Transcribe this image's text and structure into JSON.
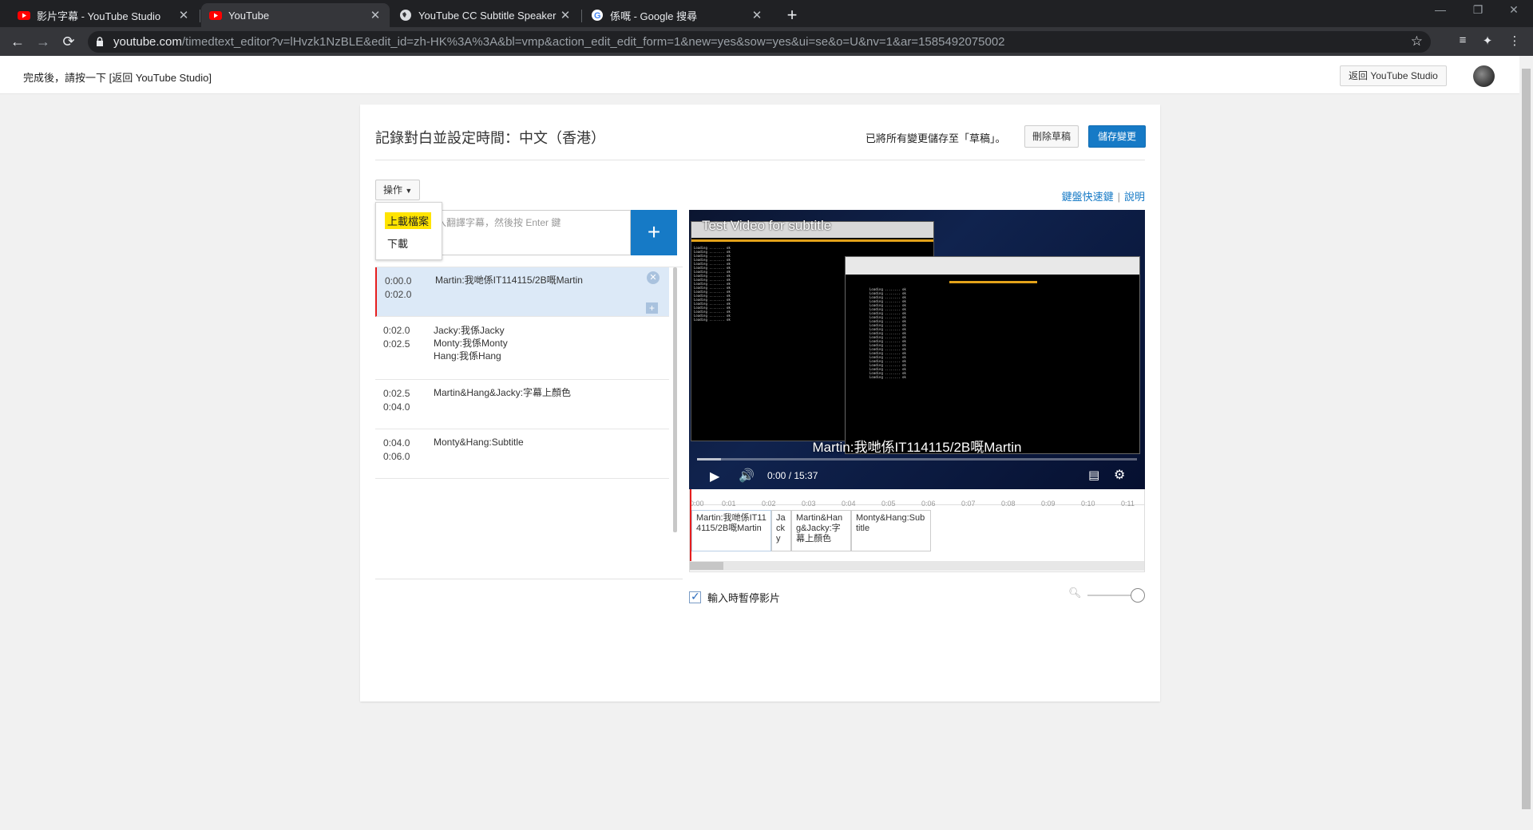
{
  "browser": {
    "tabs": [
      {
        "title": "影片字幕 - YouTube Studio",
        "icon": "youtube-icon"
      },
      {
        "title": "YouTube",
        "icon": "youtube-icon"
      },
      {
        "title": "YouTube CC Subtitle Speaker C",
        "icon": "globe-icon"
      },
      {
        "title": "係嘅 - Google 搜尋",
        "icon": "google-icon"
      }
    ],
    "url_host": "youtube.com",
    "url_rest": "/timedtext_editor?v=lHvzk1NzBLE&edit_id=zh-HK%3A%3A&bl=vmp&action_edit_edit_form=1&new=yes&sow=yes&ui=se&o=U&nv=1&ar=1585492075002"
  },
  "header": {
    "hint": "完成後，請按一下 [返回 YouTube Studio]",
    "back_button": "返回 YouTube Studio"
  },
  "editor": {
    "title": "記錄對白並設定時間：中文（香港）",
    "saved_message": "已將所有變更儲存至「草稿」。",
    "delete_draft": "刪除草稿",
    "save_changes": "儲存變更",
    "actions_label": "操作",
    "actions_menu": [
      "上載檔案",
      "下載"
    ],
    "shortcuts_link": "鍵盤快速鍵",
    "help_link": "說明",
    "input_placeholder": "入翻譯字幕，然後按 Enter 鍵",
    "captions": [
      {
        "start": "0:00.0",
        "end": "0:02.0",
        "lines": [
          "Martin:我哋係IT114115/2B嘅Martin"
        ]
      },
      {
        "start": "0:02.0",
        "end": "0:02.5",
        "lines": [
          "Jacky:我係Jacky",
          "Monty:我係Monty",
          "Hang:我係Hang"
        ]
      },
      {
        "start": "0:02.5",
        "end": "0:04.0",
        "lines": [
          "Martin&Hang&Jacky:字幕上顏色"
        ]
      },
      {
        "start": "0:04.0",
        "end": "0:06.0",
        "lines": [
          "Monty&Hang:Subtitle"
        ]
      }
    ],
    "pause_while_typing": "輸入時暫停影片"
  },
  "video": {
    "title": "Test Video for subtitle",
    "subtitle": "Martin:我哋係IT114115/2B嘅Martin",
    "time": "0:00 / 15:37"
  },
  "timeline": {
    "ticks": [
      "0:00",
      "0:01",
      "0:02",
      "0:03",
      "0:04",
      "0:05",
      "0:06",
      "0:07",
      "0:08",
      "0:09",
      "0:10",
      "0:11"
    ],
    "cues": [
      "Martin:我哋係IT114115/2B嘅Martin",
      "Jacky",
      "Martin&Hang&Jacky:字幕上顏色",
      "Monty&Hang:Subtitle"
    ]
  },
  "colors": {
    "accent": "#167ac6",
    "highlight": "#ffe400",
    "playhead": "#e61e1e"
  }
}
